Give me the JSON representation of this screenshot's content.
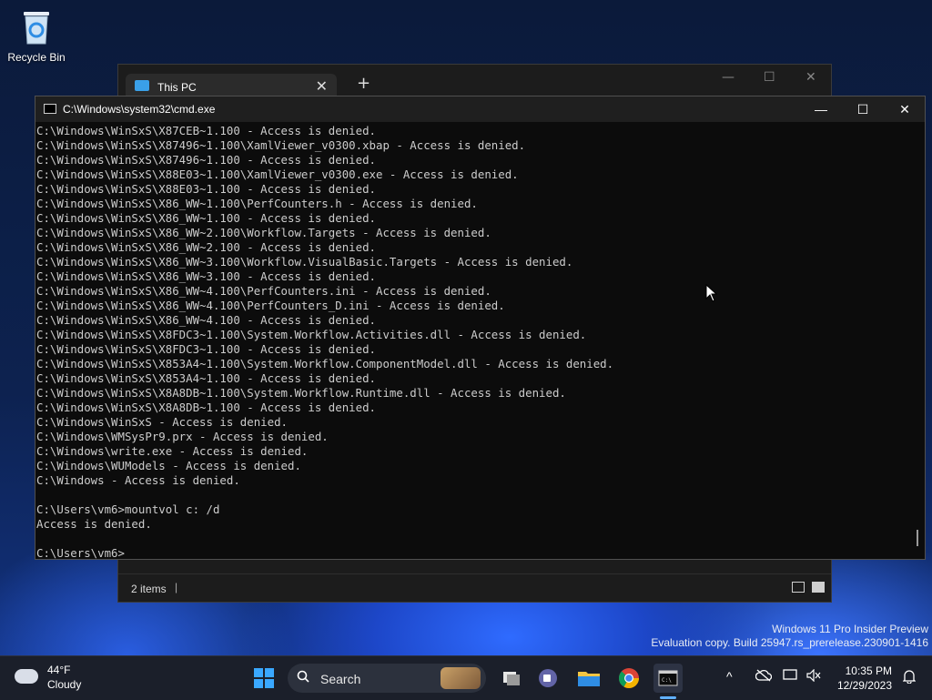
{
  "desktop": {
    "recycle_bin_label": "Recycle Bin",
    "watermark_line1": "Windows 11 Pro Insider Preview",
    "watermark_line2": "Evaluation copy. Build 25947.rs_prerelease.230901-1416"
  },
  "explorer": {
    "tab_title": "This PC",
    "tab_close": "✕",
    "new_tab": "+",
    "minimize": "—",
    "maximize": "☐",
    "close": "✕",
    "status_items": "2 items",
    "status_sep": "|"
  },
  "cmd": {
    "title": "C:\\Windows\\system32\\cmd.exe",
    "minimize": "—",
    "maximize": "☐",
    "close": "✕",
    "lines": [
      "C:\\Windows\\WinSxS\\X87CEB~1.100 - Access is denied.",
      "C:\\Windows\\WinSxS\\X87496~1.100\\XamlViewer_v0300.xbap - Access is denied.",
      "C:\\Windows\\WinSxS\\X87496~1.100 - Access is denied.",
      "C:\\Windows\\WinSxS\\X88E03~1.100\\XamlViewer_v0300.exe - Access is denied.",
      "C:\\Windows\\WinSxS\\X88E03~1.100 - Access is denied.",
      "C:\\Windows\\WinSxS\\X86_WW~1.100\\PerfCounters.h - Access is denied.",
      "C:\\Windows\\WinSxS\\X86_WW~1.100 - Access is denied.",
      "C:\\Windows\\WinSxS\\X86_WW~2.100\\Workflow.Targets - Access is denied.",
      "C:\\Windows\\WinSxS\\X86_WW~2.100 - Access is denied.",
      "C:\\Windows\\WinSxS\\X86_WW~3.100\\Workflow.VisualBasic.Targets - Access is denied.",
      "C:\\Windows\\WinSxS\\X86_WW~3.100 - Access is denied.",
      "C:\\Windows\\WinSxS\\X86_WW~4.100\\PerfCounters.ini - Access is denied.",
      "C:\\Windows\\WinSxS\\X86_WW~4.100\\PerfCounters_D.ini - Access is denied.",
      "C:\\Windows\\WinSxS\\X86_WW~4.100 - Access is denied.",
      "C:\\Windows\\WinSxS\\X8FDC3~1.100\\System.Workflow.Activities.dll - Access is denied.",
      "C:\\Windows\\WinSxS\\X8FDC3~1.100 - Access is denied.",
      "C:\\Windows\\WinSxS\\X853A4~1.100\\System.Workflow.ComponentModel.dll - Access is denied.",
      "C:\\Windows\\WinSxS\\X853A4~1.100 - Access is denied.",
      "C:\\Windows\\WinSxS\\X8A8DB~1.100\\System.Workflow.Runtime.dll - Access is denied.",
      "C:\\Windows\\WinSxS\\X8A8DB~1.100 - Access is denied.",
      "C:\\Windows\\WinSxS - Access is denied.",
      "C:\\Windows\\WMSysPr9.prx - Access is denied.",
      "C:\\Windows\\write.exe - Access is denied.",
      "C:\\Windows\\WUModels - Access is denied.",
      "C:\\Windows - Access is denied.",
      "",
      "C:\\Users\\vm6>mountvol c: /d",
      "Access is denied.",
      "",
      "C:\\Users\\vm6>"
    ]
  },
  "taskbar": {
    "weather_temp": "44°F",
    "weather_condition": "Cloudy",
    "search_label": "Search",
    "time": "10:35 PM",
    "date": "12/29/2023",
    "tray_chevron": "^"
  },
  "colors": {
    "accent": "#3aa8ff",
    "console_bg": "#0c0c0c",
    "console_text": "#cccccc"
  }
}
